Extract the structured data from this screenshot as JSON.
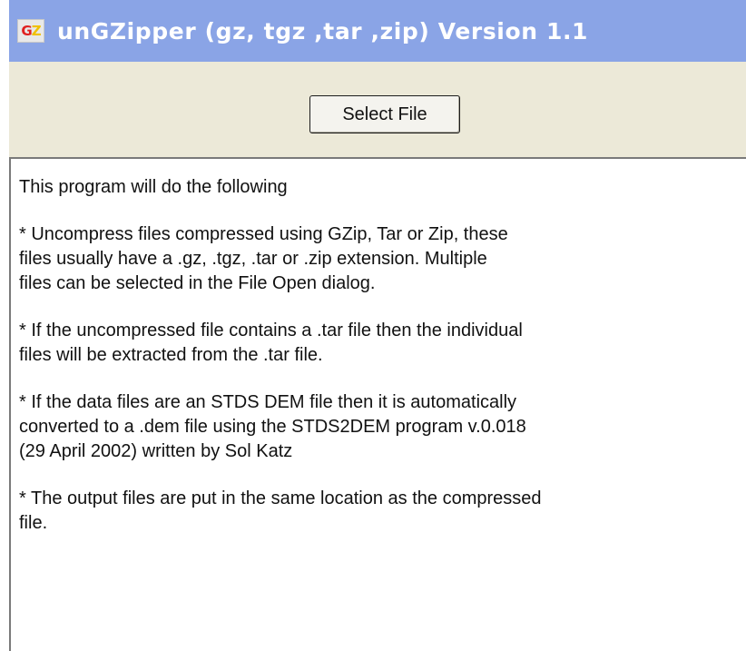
{
  "window": {
    "icon_letters": {
      "first": "G",
      "second": "Z"
    },
    "title": "unGZipper (gz, tgz ,tar ,zip) Version 1.1"
  },
  "toolbar": {
    "select_file_label": "Select File"
  },
  "content": {
    "intro": "This program will do the following",
    "paragraphs": [
      "* Uncompress files compressed using GZip, Tar or Zip, these\nfiles usually have a .gz, .tgz, .tar or .zip extension. Multiple\nfiles can be selected in the File Open dialog.",
      "* If the uncompressed file contains a .tar file then the individual\nfiles will be extracted from the .tar file.",
      "* If the data files are an STDS DEM file then it is automatically\nconverted to a .dem file using the STDS2DEM program v.0.018\n(29 April 2002) written by Sol Katz",
      "* The output files are put in the same location as the compressed\nfile."
    ]
  },
  "colors": {
    "titlebar": "#8aa4e6",
    "toolbar": "#ece9d8",
    "content_bg": "#ffffff"
  }
}
